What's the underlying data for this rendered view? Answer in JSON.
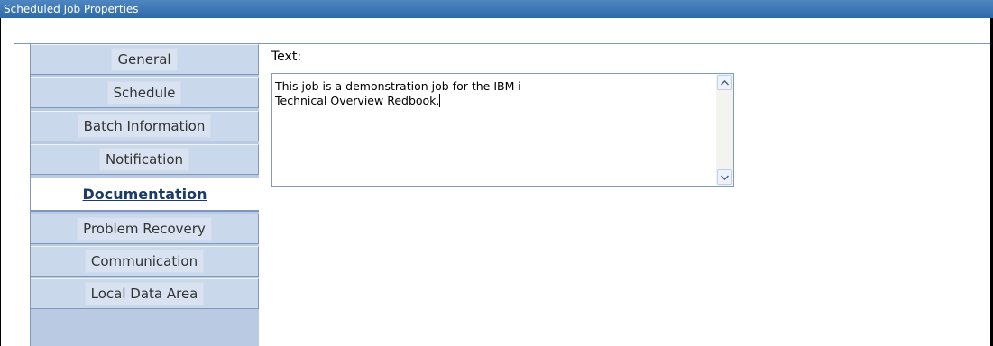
{
  "window": {
    "title": "Scheduled Job Properties"
  },
  "tabs": [
    {
      "label": "General",
      "active": false
    },
    {
      "label": "Schedule",
      "active": false
    },
    {
      "label": "Batch Information",
      "active": false
    },
    {
      "label": "Notification",
      "active": false
    },
    {
      "label": "Documentation",
      "active": true
    },
    {
      "label": "Problem Recovery",
      "active": false
    },
    {
      "label": "Communication",
      "active": false
    },
    {
      "label": "Local Data Area",
      "active": false
    }
  ],
  "documentation": {
    "text_label": "Text:",
    "text_line1": "This job is a demonstration job for the IBM i",
    "text_line2": "Technical Overview Redbook."
  },
  "icons": {
    "scroll_up": "scroll-up-arrow-icon",
    "scroll_down": "scroll-down-arrow-icon"
  },
  "colors": {
    "title_bar": "#2e6aa8",
    "tab_bg": "#cad8ec",
    "sidebar_bg": "#b9cae2",
    "active_tab_text": "#1d3b67"
  }
}
